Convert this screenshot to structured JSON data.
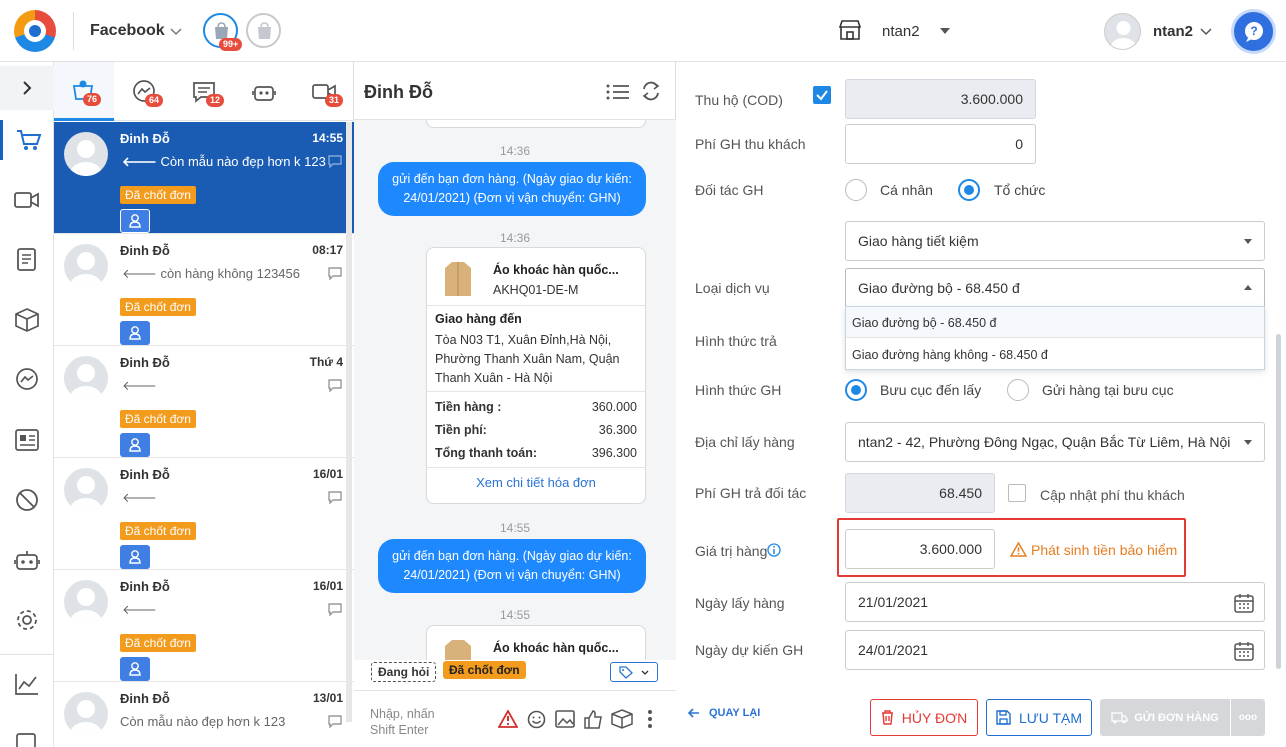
{
  "header": {
    "platform": "Facebook",
    "shop_badge": "99+",
    "shop_name": "ntan2",
    "user_name": "ntan2"
  },
  "tabs": [
    {
      "icon": "cart-user-icon",
      "count": "76"
    },
    {
      "icon": "messenger-icon",
      "count": "64"
    },
    {
      "icon": "comment-icon",
      "count": "12"
    },
    {
      "icon": "bot-icon",
      "count": ""
    },
    {
      "icon": "video-icon",
      "count": "31"
    }
  ],
  "conversations": [
    {
      "name": "Đinh Đỗ",
      "time": "14:55",
      "message": "Còn mẫu nào đẹp hơn k 123",
      "tag": "Đã chốt đơn"
    },
    {
      "name": "Đinh Đỗ",
      "time": "08:17",
      "message": "còn hàng không 123456",
      "tag": "Đã chốt đơn"
    },
    {
      "name": "Đinh Đỗ",
      "time": "Thứ 4",
      "message": "",
      "tag": "Đã chốt đơn"
    },
    {
      "name": "Đinh Đỗ",
      "time": "16/01",
      "message": "",
      "tag": "Đã chốt đơn"
    },
    {
      "name": "Đinh Đỗ",
      "time": "16/01",
      "message": "",
      "tag": "Đã chốt đơn"
    },
    {
      "name": "Đinh Đỗ",
      "time": "13/01",
      "message": "Còn mẫu nào đẹp hơn k 123",
      "tag": ""
    }
  ],
  "chat": {
    "title": "Đinh Đỗ",
    "ts1": "14:36",
    "bubble1": "gửi đến bạn  đơn hàng. (Ngày giao dự kiến:  24/01/2021) (Đơn vị vận chuyển:  GHN)",
    "ts2": "14:36",
    "card": {
      "product_name": "Áo khoác hàn quốc...",
      "product_code": "AKHQ01-DE-M",
      "ship_to_label": "Giao hàng đến",
      "address": "Tòa N03 T1, Xuân Đỉnh,Hà Nội, Phường Thanh Xuân Nam, Quận Thanh Xuân - Hà Nội",
      "goods_label": "Tiền hàng :",
      "goods_value": "360.000",
      "fee_label": "Tiền phí:",
      "fee_value": "36.300",
      "total_label": "Tổng thanh toán:",
      "total_value": "396.300",
      "link": "Xem chi tiết hóa đơn"
    },
    "ts3": "14:55",
    "bubble2": "gửi đến bạn  đơn hàng. (Ngày giao dự kiến:  24/01/2021) (Đơn vị vận chuyển:  GHN)",
    "ts4": "14:55",
    "card2_product_name": "Áo khoác hàn quốc...",
    "tag_asking": "Đang hỏi",
    "tag_closed": "Đã chốt đơn",
    "input_placeholder_line1": "Nhập, nhấn",
    "input_placeholder_line2": "Shift Enter"
  },
  "form": {
    "cod_label": "Thu hộ (COD)",
    "cod_value": "3.600.000",
    "cod_checked": true,
    "shipfee_customer_label": "Phí GH thu khách",
    "shipfee_customer_value": "0",
    "partner_label": "Đối tác GH",
    "partner_options": [
      "Cá nhân",
      "Tổ chức"
    ],
    "partner_selected": "Tổ chức",
    "carrier_value": "Giao hàng tiết kiệm",
    "service_label": "Loại dịch vụ",
    "service_value": "Giao đường bộ - 68.450 đ",
    "service_options": [
      "Giao đường bộ - 68.450 đ",
      "Giao đường hàng không - 68.450 đ"
    ],
    "payment_label": "Hình thức trả",
    "method_label": "Hình thức GH",
    "method_options": [
      "Bưu cục đến lấy",
      "Gửi hàng tại bưu cục"
    ],
    "method_selected": "Bưu cục đến lấy",
    "pickup_address_label": "Địa chỉ lấy hàng",
    "pickup_address_value": "ntan2 - 42, Phường Đông Ngạc, Quận Bắc Từ Liêm, Hà Nội",
    "partner_fee_label": "Phí GH trả đối tác",
    "partner_fee_value": "68.450",
    "update_fee_label": "Cập nhật phí thu khách",
    "goods_value_label": "Giá trị hàng",
    "goods_value": "3.600.000",
    "insurance_warning": "Phát sinh tiền bảo hiểm",
    "pickup_date_label": "Ngày lấy hàng",
    "pickup_date": "21/01/2021",
    "delivery_date_label": "Ngày dự kiến GH",
    "delivery_date": "24/01/2021",
    "back_label": "QUAY LẠI",
    "cancel_label": "HỦY ĐƠN",
    "save_label": "LƯU TẠM",
    "send_label": "GỬI ĐƠN HÀNG",
    "more_label": "ooo"
  },
  "colors": {
    "primary": "#1e88e5",
    "selected_conv": "#1a5bb4",
    "tag_orange": "#f29b1d",
    "warning": "#e67e22",
    "cancel_red": "#e53935",
    "highlight_box": "#e53935"
  }
}
